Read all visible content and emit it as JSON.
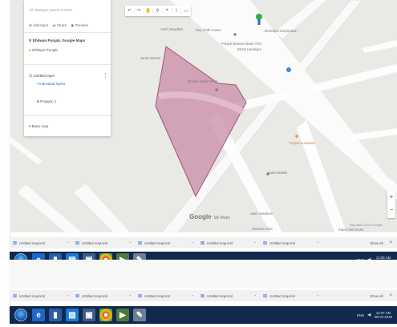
{
  "panel": {
    "heading": "All changes saved in Drive",
    "actions": [
      "Add layer",
      "Share",
      "Preview"
    ],
    "layer1_title": "Dhilwan Punjab, Google Maps",
    "layer1_sub": "Dhilwan Punjab",
    "layer2_title": "Untitled layer",
    "layer2_style": "Individual styles",
    "layer2_item": "Polygon 1",
    "base_map": "Base map"
  },
  "toolbar": {
    "buttons": [
      "↶",
      "↷",
      "✋",
      "⚲",
      "⌖",
      "⌇",
      "▭"
    ]
  },
  "map_labels": [
    {
      "text": "Amrit Jewellers",
      "cls": ""
    },
    {
      "text": "Roy Cloth House",
      "cls": ""
    },
    {
      "text": "Punjab National Bank ATM",
      "cls": ""
    },
    {
      "text": "Bhatti Hardware",
      "cls": ""
    },
    {
      "text": "Janta Sweets",
      "cls": ""
    },
    {
      "text": "Municipal Corporation",
      "cls": ""
    },
    {
      "text": "Grewal Sweet Shop",
      "cls": ""
    },
    {
      "text": "Kalra Mobile",
      "cls": ""
    },
    {
      "text": "Saini Jewellers",
      "cls": ""
    },
    {
      "text": "Sharma Clinic",
      "cls": ""
    },
    {
      "text": "Punjab Gurdwara",
      "cls": "orange"
    },
    {
      "text": "Kapur Electricals",
      "cls": ""
    }
  ],
  "google_logo": "Google",
  "google_logo_sub": "My Maps",
  "attribution": "Map data ©2018 Google",
  "zoom": {
    "plus": "+",
    "minus": "−"
  },
  "tabbar1": {
    "items": [
      "Untitled map.kml",
      "Untitled map.kml",
      "Untitled map.kml",
      "Untitled map.kml",
      "Untitled map.kml"
    ],
    "show_all": "Show all",
    "close": "×"
  },
  "taskbar1": {
    "tray": "ENG",
    "time": "12:05 AM",
    "date": "08-04-2018"
  },
  "tabbar2": {
    "items": [
      "Untitled map.kml",
      "Untitled map.kml",
      "Untitled map.kml",
      "Untitled map.kml",
      "Untitled map.kml"
    ],
    "show_all": "Show all",
    "close": "×"
  },
  "taskbar2": {
    "tray": "ENG",
    "time": "12:07 AM",
    "date": "08-04-2018"
  },
  "colors": {
    "polygon_fill": "#c98aa7",
    "polygon_stroke": "#a0587a",
    "taskbar": "#11294d"
  }
}
